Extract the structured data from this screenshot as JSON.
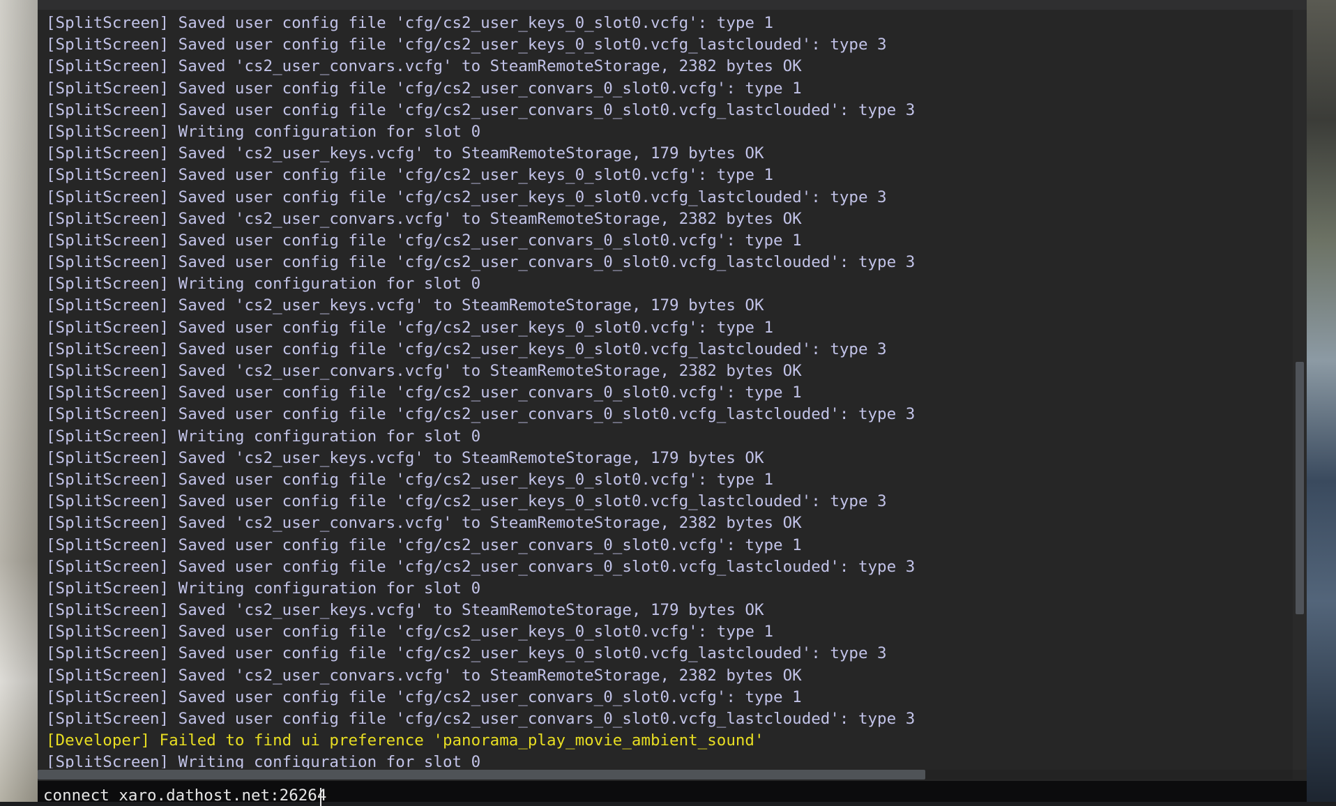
{
  "console": {
    "log_lines": [
      {
        "text": "[SplitScreen] Saved user config file 'cfg/cs2_user_keys_0_slot0.vcfg': type 1",
        "kind": "normal"
      },
      {
        "text": "[SplitScreen] Saved user config file 'cfg/cs2_user_keys_0_slot0.vcfg_lastclouded': type 3",
        "kind": "normal"
      },
      {
        "text": "[SplitScreen] Saved 'cs2_user_convars.vcfg' to SteamRemoteStorage, 2382 bytes OK",
        "kind": "normal"
      },
      {
        "text": "[SplitScreen] Saved user config file 'cfg/cs2_user_convars_0_slot0.vcfg': type 1",
        "kind": "normal"
      },
      {
        "text": "[SplitScreen] Saved user config file 'cfg/cs2_user_convars_0_slot0.vcfg_lastclouded': type 3",
        "kind": "normal"
      },
      {
        "text": "[SplitScreen] Writing configuration for slot 0",
        "kind": "normal"
      },
      {
        "text": "[SplitScreen] Saved 'cs2_user_keys.vcfg' to SteamRemoteStorage, 179 bytes OK",
        "kind": "normal"
      },
      {
        "text": "[SplitScreen] Saved user config file 'cfg/cs2_user_keys_0_slot0.vcfg': type 1",
        "kind": "normal"
      },
      {
        "text": "[SplitScreen] Saved user config file 'cfg/cs2_user_keys_0_slot0.vcfg_lastclouded': type 3",
        "kind": "normal"
      },
      {
        "text": "[SplitScreen] Saved 'cs2_user_convars.vcfg' to SteamRemoteStorage, 2382 bytes OK",
        "kind": "normal"
      },
      {
        "text": "[SplitScreen] Saved user config file 'cfg/cs2_user_convars_0_slot0.vcfg': type 1",
        "kind": "normal"
      },
      {
        "text": "[SplitScreen] Saved user config file 'cfg/cs2_user_convars_0_slot0.vcfg_lastclouded': type 3",
        "kind": "normal"
      },
      {
        "text": "[SplitScreen] Writing configuration for slot 0",
        "kind": "normal"
      },
      {
        "text": "[SplitScreen] Saved 'cs2_user_keys.vcfg' to SteamRemoteStorage, 179 bytes OK",
        "kind": "normal"
      },
      {
        "text": "[SplitScreen] Saved user config file 'cfg/cs2_user_keys_0_slot0.vcfg': type 1",
        "kind": "normal"
      },
      {
        "text": "[SplitScreen] Saved user config file 'cfg/cs2_user_keys_0_slot0.vcfg_lastclouded': type 3",
        "kind": "normal"
      },
      {
        "text": "[SplitScreen] Saved 'cs2_user_convars.vcfg' to SteamRemoteStorage, 2382 bytes OK",
        "kind": "normal"
      },
      {
        "text": "[SplitScreen] Saved user config file 'cfg/cs2_user_convars_0_slot0.vcfg': type 1",
        "kind": "normal"
      },
      {
        "text": "[SplitScreen] Saved user config file 'cfg/cs2_user_convars_0_slot0.vcfg_lastclouded': type 3",
        "kind": "normal"
      },
      {
        "text": "[SplitScreen] Writing configuration for slot 0",
        "kind": "normal"
      },
      {
        "text": "[SplitScreen] Saved 'cs2_user_keys.vcfg' to SteamRemoteStorage, 179 bytes OK",
        "kind": "normal"
      },
      {
        "text": "[SplitScreen] Saved user config file 'cfg/cs2_user_keys_0_slot0.vcfg': type 1",
        "kind": "normal"
      },
      {
        "text": "[SplitScreen] Saved user config file 'cfg/cs2_user_keys_0_slot0.vcfg_lastclouded': type 3",
        "kind": "normal"
      },
      {
        "text": "[SplitScreen] Saved 'cs2_user_convars.vcfg' to SteamRemoteStorage, 2382 bytes OK",
        "kind": "normal"
      },
      {
        "text": "[SplitScreen] Saved user config file 'cfg/cs2_user_convars_0_slot0.vcfg': type 1",
        "kind": "normal"
      },
      {
        "text": "[SplitScreen] Saved user config file 'cfg/cs2_user_convars_0_slot0.vcfg_lastclouded': type 3",
        "kind": "normal"
      },
      {
        "text": "[SplitScreen] Writing configuration for slot 0",
        "kind": "normal"
      },
      {
        "text": "[SplitScreen] Saved 'cs2_user_keys.vcfg' to SteamRemoteStorage, 179 bytes OK",
        "kind": "normal"
      },
      {
        "text": "[SplitScreen] Saved user config file 'cfg/cs2_user_keys_0_slot0.vcfg': type 1",
        "kind": "normal"
      },
      {
        "text": "[SplitScreen] Saved user config file 'cfg/cs2_user_keys_0_slot0.vcfg_lastclouded': type 3",
        "kind": "normal"
      },
      {
        "text": "[SplitScreen] Saved 'cs2_user_convars.vcfg' to SteamRemoteStorage, 2382 bytes OK",
        "kind": "normal"
      },
      {
        "text": "[SplitScreen] Saved user config file 'cfg/cs2_user_convars_0_slot0.vcfg': type 1",
        "kind": "normal"
      },
      {
        "text": "[SplitScreen] Saved user config file 'cfg/cs2_user_convars_0_slot0.vcfg_lastclouded': type 3",
        "kind": "normal"
      },
      {
        "text": "[Developer] Failed to find ui preference 'panorama_play_movie_ambient_sound'",
        "kind": "warn"
      },
      {
        "text": "[SplitScreen] Writing configuration for slot 0",
        "kind": "normal"
      }
    ],
    "input": {
      "value": "connect xaro.dathost.net:26264"
    },
    "colors": {
      "log_text": "#c2c3e8",
      "warn_text": "#e8de22",
      "background": "#262626"
    }
  }
}
